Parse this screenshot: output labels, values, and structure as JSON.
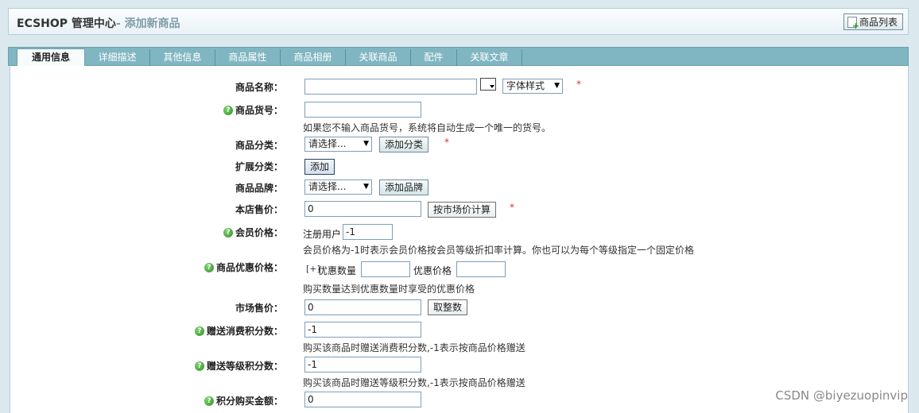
{
  "header": {
    "title": "ECSHOP 管理中心",
    "subtitle": "- 添加新商品",
    "list_button": "商品列表"
  },
  "tabs": [
    "通用信息",
    "详细描述",
    "其他信息",
    "商品属性",
    "商品相册",
    "关联商品",
    "配件",
    "关联文章"
  ],
  "form": {
    "goods_name": {
      "label": "商品名称：",
      "value": "",
      "font_style": "字体样式"
    },
    "goods_sn": {
      "label": "商品货号：",
      "value": "",
      "note": "如果您不输入商品货号，系统将自动生成一个唯一的货号。"
    },
    "category": {
      "label": "商品分类：",
      "value": "请选择...",
      "button": "添加分类"
    },
    "ext_category": {
      "label": "扩展分类：",
      "button": "添加"
    },
    "brand": {
      "label": "商品品牌：",
      "value": "请选择...",
      "button": "添加品牌"
    },
    "shop_price": {
      "label": "本店售价：",
      "value": "0",
      "button": "按市场价计算"
    },
    "member_price": {
      "label": "会员价格：",
      "user_rank": "注册用户",
      "value": "-1",
      "note": "会员价格为-1时表示会员价格按会员等级折扣率计算。你也可以为每个等级指定一个固定价格"
    },
    "volume_price": {
      "label": "商品优惠价格：",
      "toggle": "[+]",
      "qty_label": "优惠数量",
      "qty_value": "",
      "price_label": "优惠价格",
      "price_value": "",
      "note": "购买数量达到优惠数量时享受的优惠价格"
    },
    "market_price": {
      "label": "市场售价：",
      "value": "0",
      "button": "取整数"
    },
    "give_integral": {
      "label": "赠送消费积分数：",
      "value": "-1",
      "note": "购买该商品时赠送消费积分数,-1表示按商品价格赠送"
    },
    "rank_integral": {
      "label": "赠送等级积分数：",
      "value": "-1",
      "note": "购买该商品时赠送等级积分数,-1表示按商品价格赠送"
    },
    "integral": {
      "label": "积分购买金额：",
      "value": "0"
    },
    "required_mark": "*"
  },
  "watermark": "CSDN @biyezuopinvip"
}
